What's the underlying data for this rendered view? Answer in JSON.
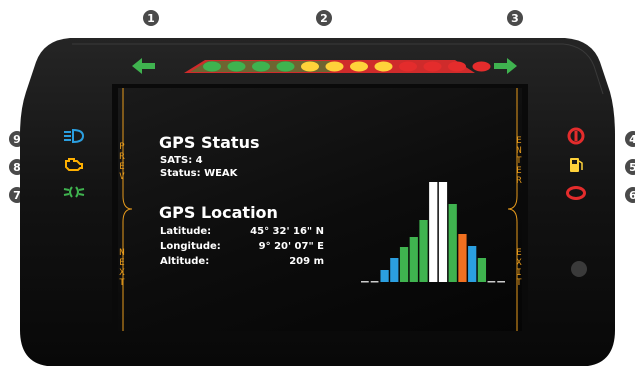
{
  "callouts": [
    "1",
    "2",
    "3",
    "4",
    "5",
    "6",
    "7",
    "8",
    "9"
  ],
  "nav": {
    "prev": "P\nR\nE\nV",
    "next": "N\nE\nX\nT",
    "enter": "E\nN\nT\nE\nR",
    "exit": "E\nX\nI\nT"
  },
  "gps_status": {
    "title": "GPS Status",
    "sats": "SATS: 4",
    "status": "Status: WEAK"
  },
  "gps_location": {
    "title": "GPS Location",
    "latitude_label": "Latitude:",
    "latitude_value": "45° 32' 16\" N",
    "longitude_label": "Longitude:",
    "longitude_value": "9° 20' 07\" E",
    "altitude_label": "Altitude:",
    "altitude_value": "209 m"
  },
  "shift_lights": [
    "green",
    "green",
    "green",
    "green",
    "yellow",
    "yellow",
    "yellow",
    "yellow",
    "red",
    "red",
    "red",
    "red"
  ],
  "signal_bars": [
    0,
    0,
    0.12,
    0.24,
    0.35,
    0.45,
    0.62,
    1.0,
    1.0,
    0.78,
    0.48,
    0.36,
    0.24,
    0,
    0
  ],
  "signal_colors": [
    "#cccccc",
    "#cccccc",
    "#2b9fe0",
    "#2b9fe0",
    "#3fb34f",
    "#3fb34f",
    "#3fb34f",
    "#ffffff",
    "#ffffff",
    "#3fb34f",
    "#f07020",
    "#2b9fe0",
    "#3fb34f",
    "#cccccc",
    "#cccccc"
  ],
  "colors": {
    "accent": "#e69a1c",
    "green": "#3fb34f",
    "blue": "#2b9fe0",
    "red": "#e42c2c",
    "yellow": "#ffd23a"
  }
}
